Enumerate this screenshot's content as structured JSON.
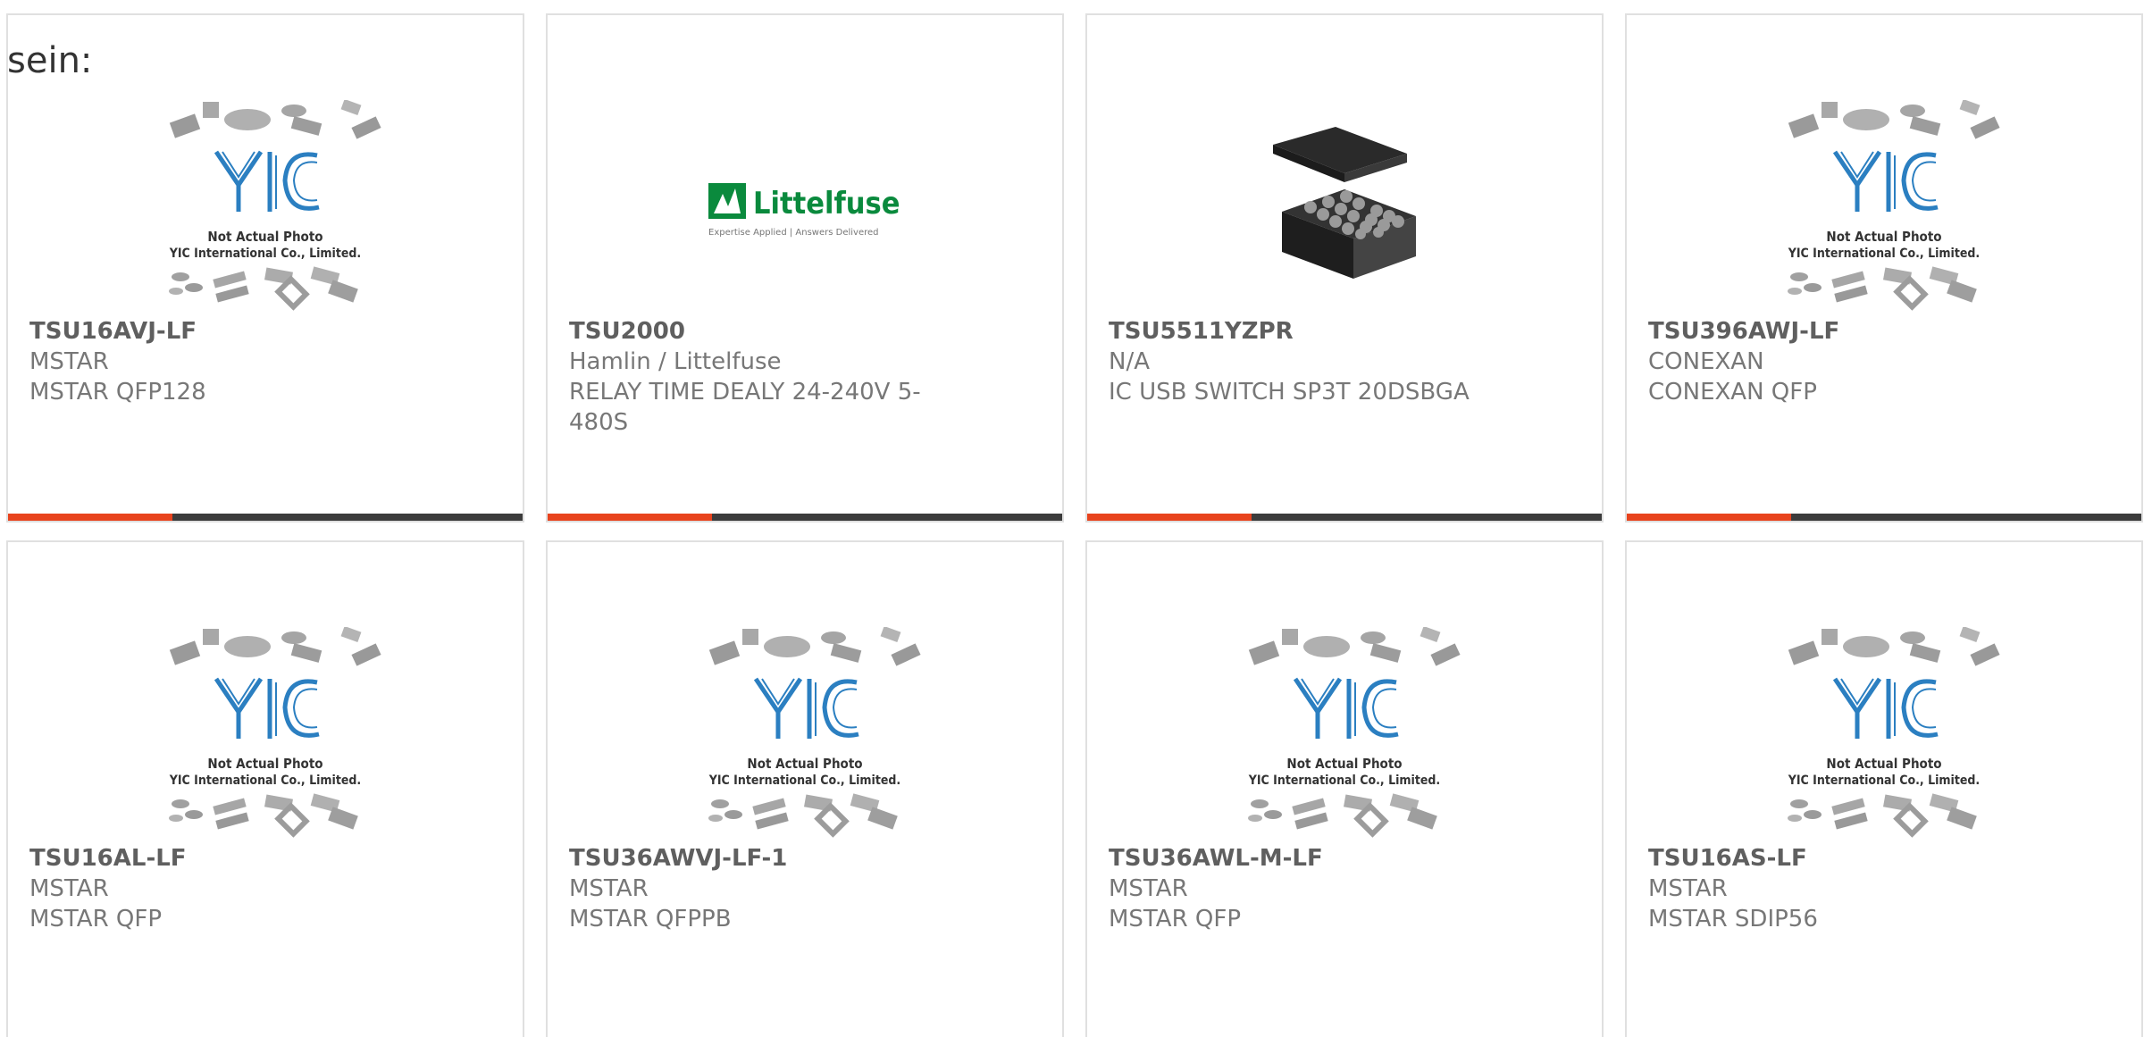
{
  "heading": "sein:",
  "placeholder_image": {
    "line1": "Not Actual Photo",
    "line2": "YIC International Co., Limited."
  },
  "littelfuse_logo": {
    "brand": "Littelfuse",
    "tagline": "Expertise Applied | Answers Delivered"
  },
  "colors": {
    "accent": "#e8431d",
    "bar_track": "#3c3c3c",
    "yic_blue": "#2b7fc1",
    "littelfuse_green": "#0a8a3d"
  },
  "products": [
    {
      "part_number": "TSU16AVJ-LF",
      "manufacturer": "MSTAR",
      "description": "MSTAR QFP128",
      "image": "yic-placeholder",
      "progress": 0.32
    },
    {
      "part_number": "TSU2000",
      "manufacturer": "Hamlin / Littelfuse",
      "description": "RELAY TIME DEALY 24-240V 5-480S",
      "image": "littelfuse-logo",
      "progress": 0.32
    },
    {
      "part_number": "TSU5511YZPR",
      "manufacturer": "N/A",
      "description": "IC USB SWITCH SP3T 20DSBGA",
      "image": "bga-chip-photo",
      "progress": 0.32
    },
    {
      "part_number": "TSU396AWJ-LF",
      "manufacturer": "CONEXAN",
      "description": "CONEXAN QFP",
      "image": "yic-placeholder",
      "progress": 0.32
    },
    {
      "part_number": "TSU16AL-LF",
      "manufacturer": "MSTAR",
      "description": "MSTAR QFP",
      "image": "yic-placeholder"
    },
    {
      "part_number": "TSU36AWVJ-LF-1",
      "manufacturer": "MSTAR",
      "description": "MSTAR QFPPB",
      "image": "yic-placeholder"
    },
    {
      "part_number": "TSU36AWL-M-LF",
      "manufacturer": "MSTAR",
      "description": "MSTAR QFP",
      "image": "yic-placeholder"
    },
    {
      "part_number": "TSU16AS-LF",
      "manufacturer": "MSTAR",
      "description": "MSTAR SDIP56",
      "image": "yic-placeholder"
    }
  ]
}
